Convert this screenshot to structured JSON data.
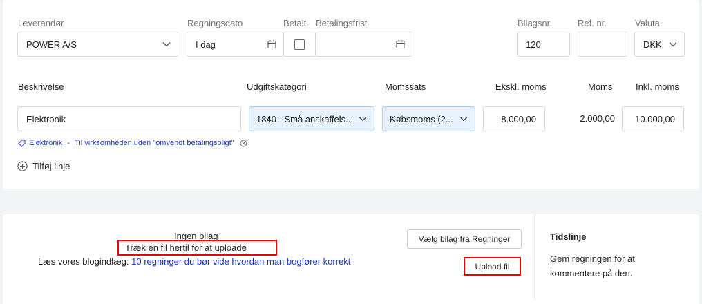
{
  "vendor": {
    "label": "Leverandør",
    "value": "POWER A/S"
  },
  "invoice_date": {
    "label": "Regningsdato",
    "value": "I dag"
  },
  "paid": {
    "label": "Betalt"
  },
  "due_date": {
    "label": "Betalingsfrist",
    "value": ""
  },
  "voucher_no": {
    "label": "Bilagsnr.",
    "value": "120"
  },
  "ref_no": {
    "label": "Ref. nr.",
    "value": ""
  },
  "currency": {
    "label": "Valuta",
    "value": "DKK"
  },
  "lines": {
    "headers": {
      "description": "Beskrivelse",
      "category": "Udgiftskategori",
      "vat_rate": "Momssats",
      "excl_vat": "Ekskl. moms",
      "vat": "Moms",
      "incl_vat": "Inkl. moms"
    },
    "row": {
      "description": "Elektronik",
      "category": "1840 - Små anskaffels...",
      "vat_rate": "Købsmoms (2...",
      "excl_vat": "8.000,00",
      "vat": "2.000,00",
      "incl_vat": "10.000,00"
    },
    "tag": {
      "name": "Elektronik",
      "separator": "-",
      "text": "Til virksomheden uden \"omvendt betalingspligt\""
    },
    "add_line": "Tilføj linje"
  },
  "attachments": {
    "none": "Ingen bilag",
    "drag_hint": "Træk en fil hertil for at uploade",
    "blog_prefix": "Læs vores blogindlæg:",
    "blog_link": "10 regninger du bør vide hvordan man bogfører korrekt",
    "choose_button": "Vælg bilag fra Regninger",
    "upload_button": "Upload fil"
  },
  "timeline": {
    "title": "Tidslinje",
    "text_line1": "Gem regningen for at",
    "text_line2": "kommentere på den."
  },
  "colors": {
    "accent_link": "#1a3bb3",
    "highlight_border": "#e00000",
    "select_blue_bg": "#e6f1fb"
  }
}
